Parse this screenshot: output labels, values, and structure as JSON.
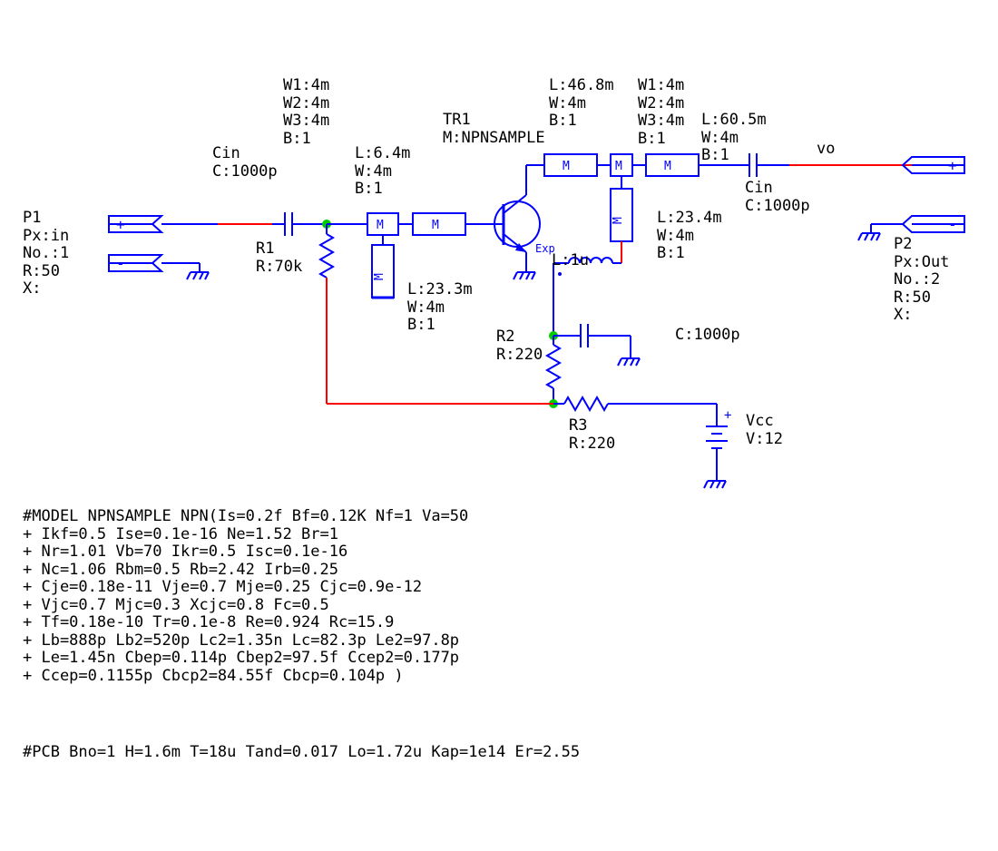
{
  "ports": {
    "p1": {
      "name": "P1",
      "px": "Px:in",
      "no": "No.:1",
      "r": "R:50",
      "x": "X:"
    },
    "p2": {
      "name": "P2",
      "px": "Px:Out",
      "no": "No.:2",
      "r": "R:50",
      "x": "X:"
    }
  },
  "cin1": {
    "name": "Cin",
    "val": "C:1000p"
  },
  "cin2": {
    "name": "Cin",
    "val": "C:1000p"
  },
  "r1": {
    "name": "R1",
    "val": "R:70k"
  },
  "r2": {
    "name": "R2",
    "val": "R:220"
  },
  "r3": {
    "name": "R3",
    "val": "R:220"
  },
  "vcc": {
    "name": "Vcc",
    "val": "V:12"
  },
  "tr1": {
    "name": "TR1",
    "model": "M:NPNSAMPLE",
    "exp": "Exp"
  },
  "inductor": {
    "val": "L:1u"
  },
  "c3": {
    "val": "C:1000p"
  },
  "vo": "vo",
  "ms": {
    "tee1": {
      "w1": "W1:4m",
      "w2": "W2:4m",
      "w3": "W3:4m",
      "b": "B:1"
    },
    "line1": {
      "l": "L:6.4m",
      "w": "W:4m",
      "b": "B:1"
    },
    "stub1": {
      "l": "L:23.3m",
      "w": "W:4m",
      "b": "B:1"
    },
    "topL": {
      "val": "L:46.8m",
      "w": "W:4m",
      "b": "B:1"
    },
    "tee2": {
      "w1": "W1:4m",
      "w2": "W2:4m",
      "w3": "W3:4m",
      "b": "B:1"
    },
    "line2": {
      "l": "L:60.5m",
      "w": "W:4m",
      "b": "B:1"
    },
    "stub2": {
      "l": "L:23.4m",
      "w": "W:4m",
      "b": "B:1"
    }
  },
  "model_text": "#MODEL NPNSAMPLE NPN(Is=0.2f Bf=0.12K Nf=1 Va=50\n+ Ikf=0.5 Ise=0.1e-16 Ne=1.52 Br=1\n+ Nr=1.01 Vb=70 Ikr=0.5 Isc=0.1e-16\n+ Nc=1.06 Rbm=0.5 Rb=2.42 Irb=0.25\n+ Cje=0.18e-11 Vje=0.7 Mje=0.25 Cjc=0.9e-12\n+ Vjc=0.7 Mjc=0.3 Xcjc=0.8 Fc=0.5\n+ Tf=0.18e-10 Tr=0.1e-8 Re=0.924 Rc=15.9\n+ Lb=888p Lb2=520p Lc2=1.35n Lc=82.3p Le2=97.8p\n+ Le=1.45n Cbep=0.114p Cbep2=97.5f Ccep2=0.177p\n+ Ccep=0.1155p Cbcp2=84.55f Cbcp=0.104p )",
  "pcb_text": "#PCB Bno=1 H=1.6m T=18u Tand=0.017 Lo=1.72u Kap=1e14 Er=2.55"
}
